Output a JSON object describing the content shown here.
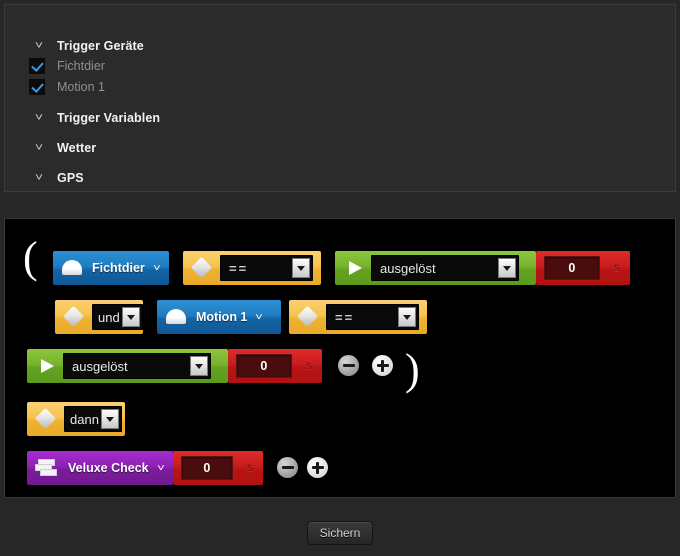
{
  "tree": {
    "groups": [
      {
        "label": "Trigger Geräte",
        "caret": "chevron-down-icon"
      },
      {
        "label": "Trigger Variablen",
        "caret": "chevron-down-icon"
      },
      {
        "label": "Wetter",
        "caret": "chevron-down-icon"
      },
      {
        "label": "GPS",
        "caret": "chevron-down-icon"
      }
    ],
    "devices": [
      {
        "label": "Fichtdier",
        "checked": true
      },
      {
        "label": "Motion 1",
        "checked": true
      }
    ]
  },
  "workspace": {
    "open_paren": "(",
    "close_paren": ")",
    "rows": [
      {
        "device": {
          "label": "Fichtdier",
          "icon": "lamp-icon",
          "caret": "chevron-down-icon"
        },
        "operator": {
          "value": "==",
          "icon": "diamond-icon"
        },
        "state": {
          "value": "ausgelöst",
          "icon": "play-icon"
        },
        "delay": {
          "value": "0",
          "unit": "s"
        }
      },
      {
        "conjunction": {
          "value": "und",
          "icon": "diamond-icon"
        },
        "device": {
          "label": "Motion 1",
          "icon": "lamp-icon",
          "caret": "chevron-down-icon"
        },
        "operator": {
          "value": "==",
          "icon": "diamond-icon"
        }
      },
      {
        "state": {
          "value": "ausgelöst",
          "icon": "play-icon"
        },
        "delay": {
          "value": "0",
          "unit": "s"
        },
        "minus": "minus-button",
        "plus": "plus-button"
      },
      {
        "then": {
          "value": "dann",
          "icon": "diamond-icon"
        }
      },
      {
        "action": {
          "label": "Veluxe Check",
          "icon": "scene-icon",
          "caret": "chevron-down-icon"
        },
        "delay": {
          "value": "0",
          "unit": "s"
        },
        "minus": "minus-button",
        "plus": "plus-button"
      }
    ]
  },
  "footer": {
    "save_label": "Sichern"
  },
  "colors": {
    "device_blue": "#1f7ec2",
    "operator_yellow": "#f6c34f",
    "state_green": "#78b32e",
    "delay_red": "#c81c1c",
    "action_purple": "#8e23b4",
    "checkbox_blue": "#3d9ae2",
    "panel_bg": "#2b2b2b",
    "workspace_bg": "#000000"
  }
}
